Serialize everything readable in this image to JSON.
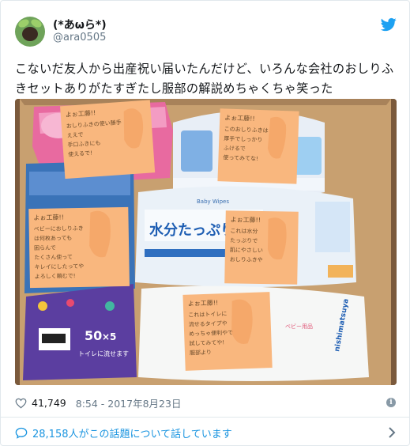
{
  "user": {
    "display_name": "(*あωら*)",
    "handle": "@ara0505"
  },
  "tweet": {
    "text": "こないだ友人から出産祝い届いたんだけど、いろんな会社のおしりふきセットありがたすぎたし服部の解説めちゃくちゃ笑った"
  },
  "photo": {
    "notes": {
      "n1": {
        "title": "よぉ工藤!!",
        "lines": [
          "おしりふきの使い勝手",
          "ええで",
          "手口ふきにも",
          "使えるで!"
        ]
      },
      "n2": {
        "title": "よぉ工藤!!",
        "lines": [
          "このおしりふきは",
          "厚手でしっかり",
          "ふけるで",
          "使ってみてな!"
        ]
      },
      "n3": {
        "title": "よぉ工藤!!",
        "lines": [
          "ベビーにおしりふき",
          "は何枚あっても",
          "困らんで",
          "たくさん使って",
          "キレイにしたってや",
          "よろしく頼むで!"
        ]
      },
      "n4": {
        "title": "よぉ工藤!!",
        "lines": [
          "これは水分",
          "たっぷりで",
          "肌にやさしい",
          "おしりふきや"
        ]
      },
      "n5": {
        "title": "よぉ工藤!!",
        "lines": [
          "これはトイレに",
          "流せるタイプや",
          "めっちゃ便利やで",
          "試してみてや!",
          "服部より"
        ]
      }
    },
    "labels": {
      "water": "水分たっぷり",
      "fifty": "50",
      "five": "×5",
      "toilet": "トイレに流せます",
      "brand": "nishimatsuya",
      "small_a": "ベビー用品",
      "small_b": "Baby Wipes"
    }
  },
  "meta": {
    "likes": "41,749",
    "timestamp": "8:54 - 2017年8月23日",
    "info_icon_label": "i"
  },
  "footer": {
    "talking": "28,158人がこの話題について話しています"
  },
  "colors": {
    "link": "#1b95e0",
    "secondary": "#657786",
    "border": "#e1e8ed",
    "twitter_blue": "#1da1f2"
  },
  "icons": {
    "like": "heart-outline-icon",
    "conversation": "speech-bubble-icon",
    "twitter": "twitter-bird-icon",
    "info": "info-icon",
    "chevron": "chevron-right-icon"
  }
}
